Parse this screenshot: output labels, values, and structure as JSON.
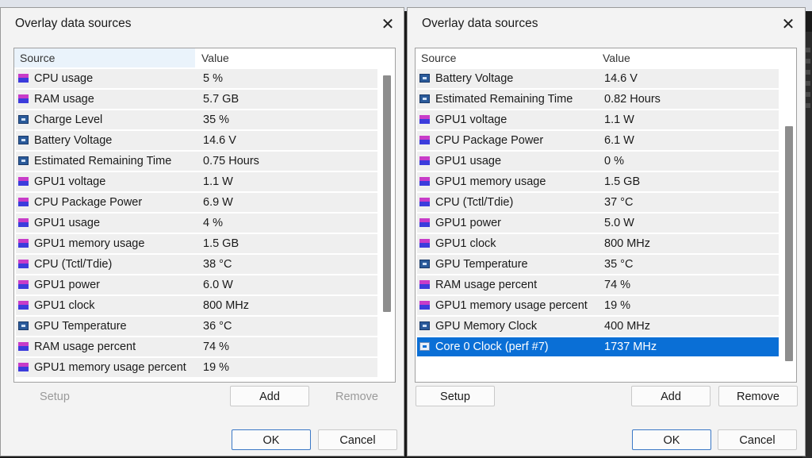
{
  "left": {
    "title": "Overlay data sources",
    "close_glyph": "✕",
    "columns": {
      "source": "Source",
      "value": "Value"
    },
    "rows": [
      {
        "icon": "memory-icon",
        "name": "CPU usage",
        "value": "5 %"
      },
      {
        "icon": "memory-icon",
        "name": "RAM usage",
        "value": "5.7 GB"
      },
      {
        "icon": "battery-icon",
        "name": "Charge Level",
        "value": "35 %"
      },
      {
        "icon": "battery-icon",
        "name": "Battery Voltage",
        "value": "14.6 V"
      },
      {
        "icon": "battery-icon",
        "name": "Estimated Remaining Time",
        "value": "0.75 Hours"
      },
      {
        "icon": "memory-icon",
        "name": "GPU1 voltage",
        "value": "1.1 W"
      },
      {
        "icon": "memory-icon",
        "name": "CPU Package Power",
        "value": "6.9 W"
      },
      {
        "icon": "memory-icon",
        "name": "GPU1 usage",
        "value": "4 %"
      },
      {
        "icon": "memory-icon",
        "name": "GPU1 memory usage",
        "value": "1.5 GB"
      },
      {
        "icon": "memory-icon",
        "name": "CPU (Tctl/Tdie)",
        "value": "38 °C"
      },
      {
        "icon": "memory-icon",
        "name": "GPU1 power",
        "value": "6.0 W"
      },
      {
        "icon": "memory-icon",
        "name": "GPU1 clock",
        "value": "800 MHz"
      },
      {
        "icon": "battery-icon",
        "name": "GPU Temperature",
        "value": "36 °C"
      },
      {
        "icon": "memory-icon",
        "name": "RAM usage percent",
        "value": "74 %"
      },
      {
        "icon": "memory-icon",
        "name": "GPU1 memory usage percent",
        "value": "19 %"
      }
    ],
    "buttons": {
      "setup": "Setup",
      "add": "Add",
      "remove": "Remove",
      "ok": "OK",
      "cancel": "Cancel"
    }
  },
  "right": {
    "title": "Overlay data sources",
    "close_glyph": "✕",
    "columns": {
      "source": "Source",
      "value": "Value"
    },
    "rows": [
      {
        "icon": "battery-icon",
        "name": "Battery Voltage",
        "value": "14.6 V"
      },
      {
        "icon": "battery-icon",
        "name": "Estimated Remaining Time",
        "value": "0.82 Hours"
      },
      {
        "icon": "memory-icon",
        "name": "GPU1 voltage",
        "value": "1.1 W"
      },
      {
        "icon": "memory-icon",
        "name": "CPU Package Power",
        "value": "6.1 W"
      },
      {
        "icon": "memory-icon",
        "name": "GPU1 usage",
        "value": "0 %"
      },
      {
        "icon": "memory-icon",
        "name": "GPU1 memory usage",
        "value": "1.5 GB"
      },
      {
        "icon": "memory-icon",
        "name": "CPU (Tctl/Tdie)",
        "value": "37 °C"
      },
      {
        "icon": "memory-icon",
        "name": "GPU1 power",
        "value": "5.0 W"
      },
      {
        "icon": "memory-icon",
        "name": "GPU1 clock",
        "value": "800 MHz"
      },
      {
        "icon": "battery-icon",
        "name": "GPU Temperature",
        "value": "35 °C"
      },
      {
        "icon": "memory-icon",
        "name": "RAM usage percent",
        "value": "74 %"
      },
      {
        "icon": "memory-icon",
        "name": "GPU1 memory usage percent",
        "value": "19 %"
      },
      {
        "icon": "battery-icon",
        "name": "GPU Memory Clock",
        "value": "400 MHz"
      },
      {
        "icon": "battery-icon",
        "name": "Core 0 Clock (perf #7)",
        "value": "1737 MHz",
        "selected": true
      }
    ],
    "buttons": {
      "setup": "Setup",
      "add": "Add",
      "remove": "Remove",
      "ok": "OK",
      "cancel": "Cancel"
    }
  },
  "colors": {
    "selection": "#0a6fd6",
    "default_button_border": "#3a78c6"
  }
}
